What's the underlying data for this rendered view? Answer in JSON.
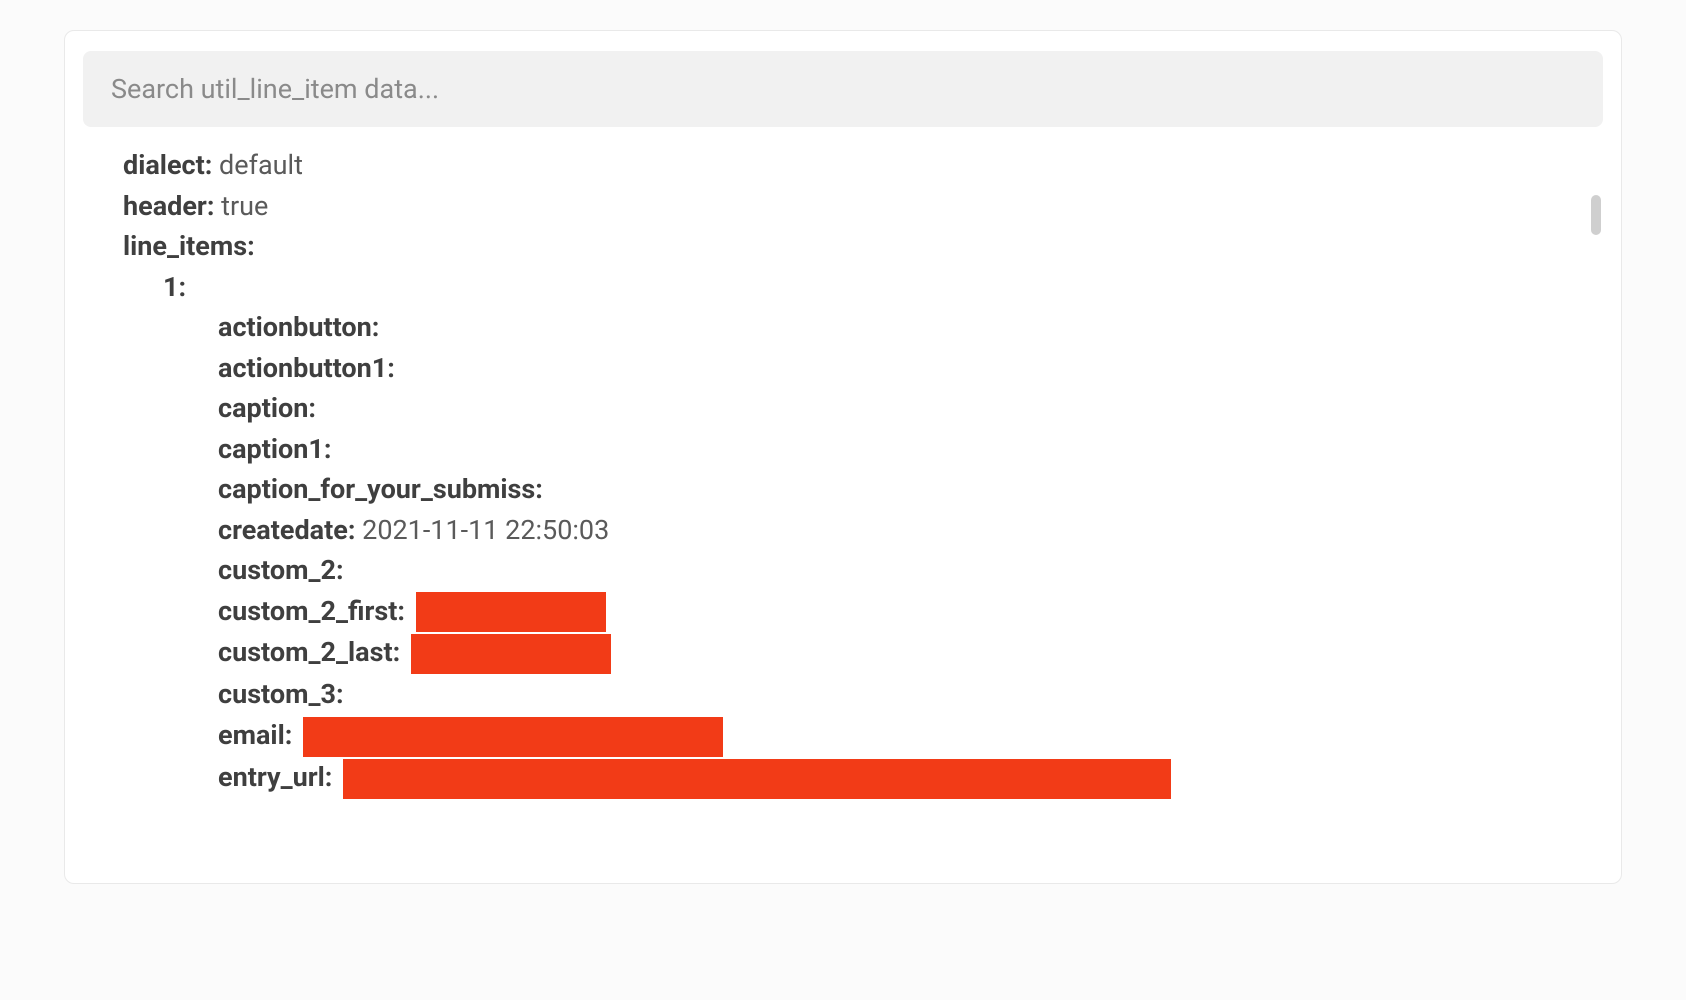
{
  "search": {
    "placeholder": "Search util_line_item data..."
  },
  "root": {
    "dialect": {
      "label": "dialect:",
      "value": "default"
    },
    "header": {
      "label": "header:",
      "value": "true"
    },
    "line_items_label": "line_items:"
  },
  "item_index_label": "1:",
  "item": {
    "actionbutton": {
      "label": "actionbutton:"
    },
    "actionbutton1": {
      "label": "actionbutton1:"
    },
    "caption": {
      "label": "caption:"
    },
    "caption1": {
      "label": "caption1:"
    },
    "caption_for_your_submiss": {
      "label": "caption_for_your_submiss:"
    },
    "createdate": {
      "label": "createdate:",
      "value": "2021-11-11 22:50:03"
    },
    "custom_2": {
      "label": "custom_2:"
    },
    "custom_2_first": {
      "label": "custom_2_first:",
      "redacted": true
    },
    "custom_2_last": {
      "label": "custom_2_last:",
      "redacted": true
    },
    "custom_3": {
      "label": "custom_3:"
    },
    "email": {
      "label": "email:",
      "redacted": true
    },
    "entry_url": {
      "label": "entry_url:",
      "redacted": true
    }
  },
  "colors": {
    "redaction": "#f23b17",
    "search_bg": "#f1f1f1"
  }
}
